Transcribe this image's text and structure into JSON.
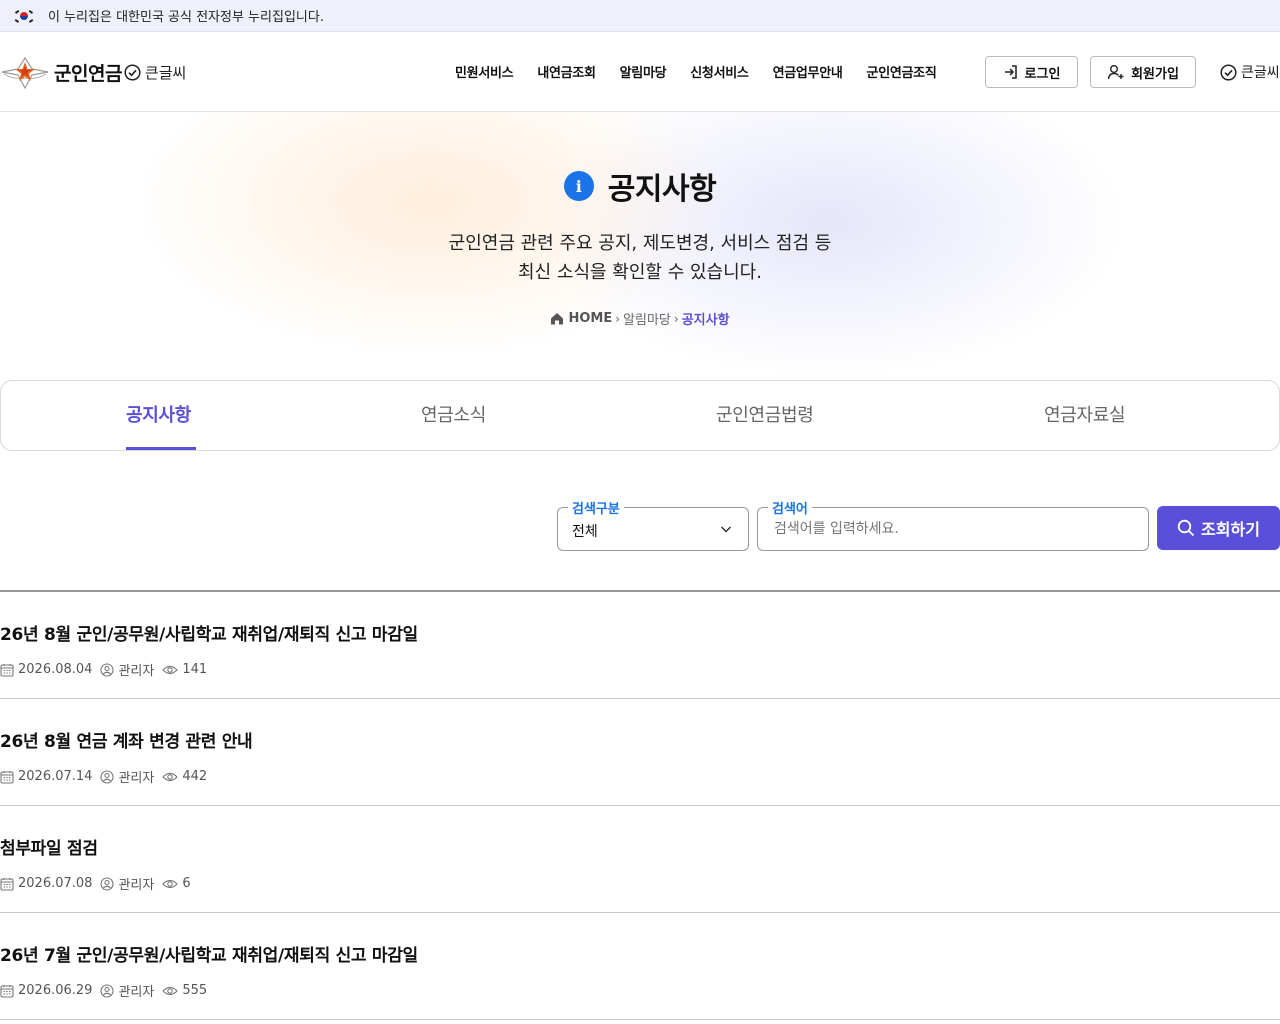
{
  "gov_banner": {
    "text": "이 누리집은 대한민국 공식 전자정부 누리집입니다."
  },
  "header": {
    "logo_text": "군인연금",
    "big_letter": "큰글씨",
    "nav": [
      "민원서비스",
      "내연금조회",
      "알림마당",
      "신청서비스",
      "연금업무안내",
      "군인연금조직"
    ],
    "login_label": "로그인",
    "join_label": "회원가입",
    "big_letter_right": "큰글씨"
  },
  "hero": {
    "title": "공지사항",
    "desc_line1": "군인연금 관련 주요 공지, 제도변경, 서비스 점검 등",
    "desc_line2": "최신 소식을 확인할 수 있습니다.",
    "breadcrumb": {
      "home": "HOME",
      "parent": "알림마당",
      "current": "공지사항"
    }
  },
  "tabs": [
    {
      "label": "공지사항",
      "active": true
    },
    {
      "label": "연금소식",
      "active": false
    },
    {
      "label": "군인연금법령",
      "active": false
    },
    {
      "label": "연금자료실",
      "active": false
    }
  ],
  "search": {
    "category_label": "검색구분",
    "category_value": "전체",
    "keyword_label": "검색어",
    "keyword_placeholder": "검색어를 입력하세요.",
    "button_label": "조회하기"
  },
  "notices": [
    {
      "title": "26년 8월 군인/공무원/사립학교 재취업/재퇴직 신고 마감일",
      "date": "2026.08.04",
      "author": "관리자",
      "views": "141"
    },
    {
      "title": "26년 8월 연금 계좌 변경 관련 안내",
      "date": "2026.07.14",
      "author": "관리자",
      "views": "442"
    },
    {
      "title": "첨부파일 점검",
      "date": "2026.07.08",
      "author": "관리자",
      "views": "6"
    },
    {
      "title": "26년 7월 군인/공무원/사립학교 재취업/재퇴직 신고 마감일",
      "date": "2026.06.29",
      "author": "관리자",
      "views": "555"
    }
  ],
  "colors": {
    "accent": "#5a4fd8",
    "info_blue": "#1a73e8"
  }
}
